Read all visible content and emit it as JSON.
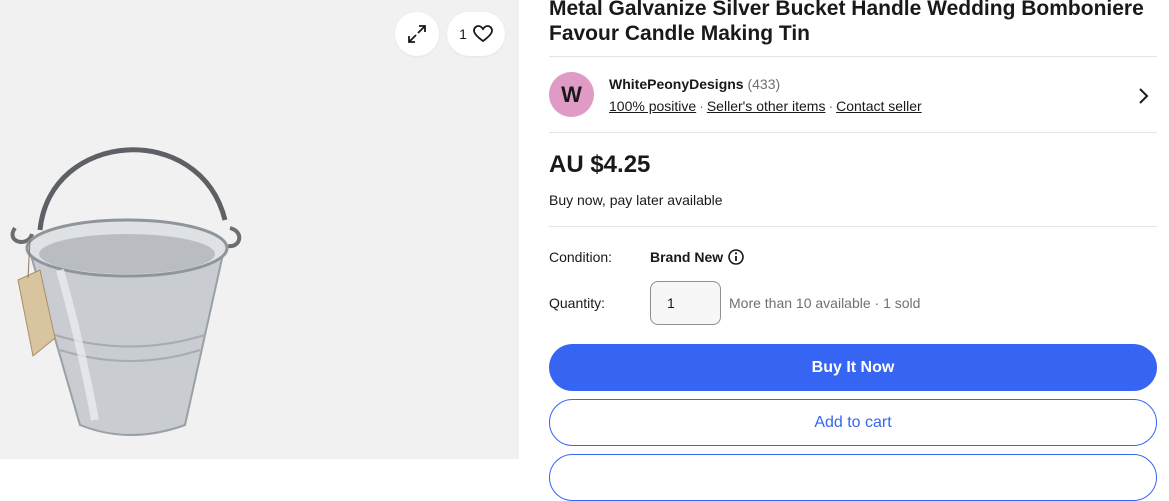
{
  "gallery": {
    "watch_count": "1",
    "icons": {
      "expand": "expand-icon",
      "heart": "heart-icon"
    }
  },
  "product": {
    "title": "Metal Galvanize Silver Bucket Handle Wedding Bomboniere Favour Candle Making Tin"
  },
  "seller": {
    "avatar_letter": "W",
    "avatar_color": "#df9bc5",
    "name": "WhitePeonyDesigns",
    "feedback_count": "(433)",
    "positive": "100% positive",
    "other_items": "Seller's other items",
    "contact": "Contact seller"
  },
  "pricing": {
    "price": "AU $4.25",
    "pay_later": "Buy now, pay later available"
  },
  "condition": {
    "label": "Condition:",
    "value": "Brand New"
  },
  "quantity": {
    "label": "Quantity:",
    "value": "1",
    "availability": "More than 10 available · 1 sold"
  },
  "actions": {
    "buy_now": "Buy It Now",
    "add_to_cart": "Add to cart"
  },
  "colors": {
    "accent": "#3665f3",
    "text": "#191919",
    "muted": "#707070"
  }
}
